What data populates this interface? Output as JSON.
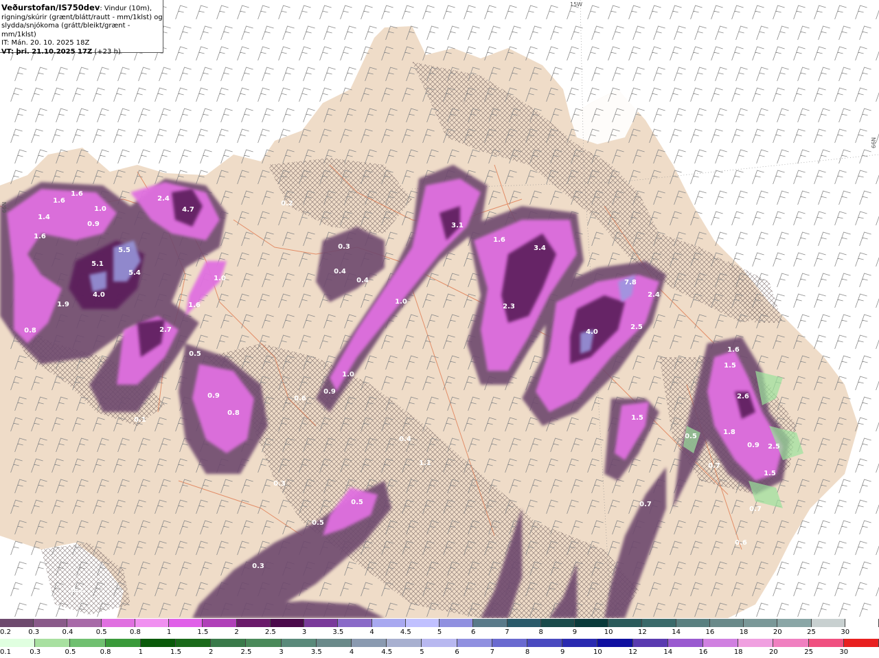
{
  "header": {
    "title": "Veðurstofan/IS750dev",
    "line1_rest": ": Vindur (10m),",
    "line2": "rigning/skúrir (grænt/blátt/rautt - mm/1klst) og",
    "line3": "slydda/snjókoma (grátt/bleikt/grænt - mm/1klst)",
    "it": "IT: Mán. 20. 10. 2025 18Z",
    "vt_main": "VT: þri. 21.10.2025 17Z",
    "vt_lead": " (+23 h)"
  },
  "grid_labels": [
    "15W",
    "66N",
    "66N"
  ],
  "colors": {
    "sea": "#ffffff",
    "land": "#efdcc8",
    "wind_barb": "#8a8a8a",
    "roads": "#e07a50",
    "hatch": "#6b5a5a",
    "precip_light": "#ee66ee",
    "precip_mid": "#c040c8",
    "precip_heavy": "#5a1a5a",
    "precip_peak": "#9a9ae0",
    "rain_green": "#9ce39c"
  },
  "value_labels": [
    {
      "t": "1.6"
    },
    {
      "t": "1.6"
    },
    {
      "t": "1.0"
    },
    {
      "t": "1.4"
    },
    {
      "t": "0.9"
    },
    {
      "t": "1.6"
    },
    {
      "t": "2.4"
    },
    {
      "t": "4.7"
    },
    {
      "t": "0.2"
    },
    {
      "t": "5.1"
    },
    {
      "t": "5.5"
    },
    {
      "t": "5.4"
    },
    {
      "t": "4.0"
    },
    {
      "t": "1.9"
    },
    {
      "t": "0.8"
    },
    {
      "t": "1.0"
    },
    {
      "t": "1.6"
    },
    {
      "t": "2.7"
    },
    {
      "t": "0.5"
    },
    {
      "t": "0.9"
    },
    {
      "t": "0.8"
    },
    {
      "t": "0.3"
    },
    {
      "t": "0.4"
    },
    {
      "t": "0.4"
    },
    {
      "t": "3.1"
    },
    {
      "t": "1.0"
    },
    {
      "t": "1.6"
    },
    {
      "t": "3.4"
    },
    {
      "t": "2.3"
    },
    {
      "t": "7.8"
    },
    {
      "t": "2.4"
    },
    {
      "t": "4.0"
    },
    {
      "t": "2.5"
    },
    {
      "t": "1.0"
    },
    {
      "t": "0.9"
    },
    {
      "t": "0.6"
    },
    {
      "t": "0.4"
    },
    {
      "t": "1.1"
    },
    {
      "t": "0.3"
    },
    {
      "t": "0.5"
    },
    {
      "t": "0.5"
    },
    {
      "t": "0.3"
    },
    {
      "t": "0.2"
    },
    {
      "t": "1.5"
    },
    {
      "t": "1.6"
    },
    {
      "t": "1.5"
    },
    {
      "t": "2.6"
    },
    {
      "t": "1.8"
    },
    {
      "t": "0.5"
    },
    {
      "t": "0.9"
    },
    {
      "t": "2.5"
    },
    {
      "t": "0.7"
    },
    {
      "t": "1.5"
    },
    {
      "t": "0.7"
    },
    {
      "t": "0.7"
    },
    {
      "t": "0.6"
    },
    {
      "t": "0.1"
    }
  ],
  "legend_snow": {
    "labels": [
      "0.2",
      "0.3",
      "0.4",
      "0.5",
      "0.8",
      "1",
      "1.5",
      "2",
      "2.5",
      "3",
      "3.5",
      "4",
      "4.5",
      "5",
      "6",
      "7",
      "8",
      "9",
      "10",
      "12",
      "14",
      "16",
      "18",
      "20",
      "25",
      "30"
    ],
    "colors": [
      "#6e4a6e",
      "#8a5a8a",
      "#a86aa8",
      "#e070e0",
      "#f090f0",
      "#e060e8",
      "#b040b8",
      "#6a1a6a",
      "#4a0a4a",
      "#7a3a9a",
      "#8a6ac8",
      "#a8a8f0",
      "#c0c0ff",
      "#9090e0",
      "#5a7a8a",
      "#2a5a6a",
      "#1a4a4a",
      "#0a3a3a",
      "#2a5a5a",
      "#3a6a6a",
      "#5a8080",
      "#6a8a8a",
      "#7a9898",
      "#8aa6a6",
      "#c8d0d0",
      "#ffffff"
    ]
  },
  "legend_rain": {
    "labels": [
      "0.1",
      "0.3",
      "0.5",
      "0.8",
      "1",
      "1.5",
      "2",
      "2.5",
      "3",
      "3.5",
      "4",
      "4.5",
      "5",
      "6",
      "7",
      "8",
      "9",
      "10",
      "12",
      "14",
      "16",
      "18",
      "20",
      "25",
      "30"
    ],
    "colors": [
      "#e0ffe0",
      "#a8e0a0",
      "#70c070",
      "#3a9a3a",
      "#0a5a0a",
      "#1a6a1a",
      "#3a7a4a",
      "#4a8a5a",
      "#5a8a7a",
      "#6a8a8a",
      "#8a9ab0",
      "#a8b0d0",
      "#b8b8f0",
      "#9090e0",
      "#6a6ad0",
      "#4a4ac0",
      "#2a2ab0",
      "#1010a0",
      "#5a3ab0",
      "#9a5ad0",
      "#d080e0",
      "#f0a0e0",
      "#f080c0",
      "#f05080",
      "#e82020"
    ]
  }
}
